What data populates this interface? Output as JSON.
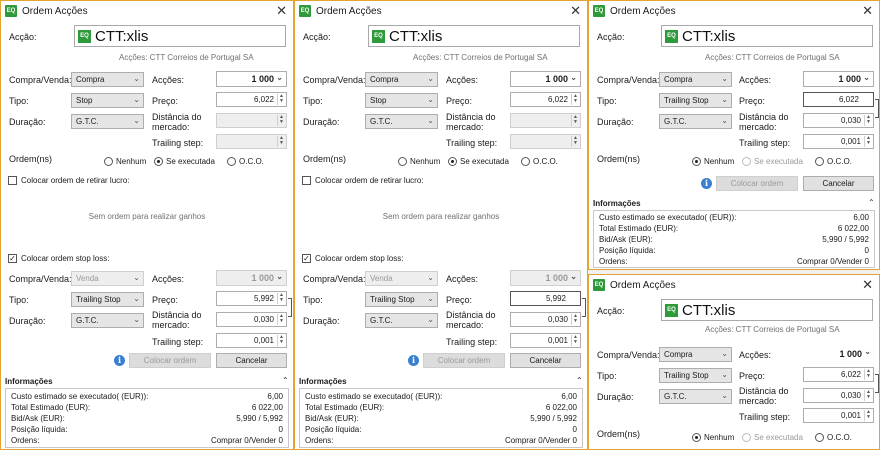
{
  "window_title": "Ordem Acções",
  "app_icon": "EQ",
  "symbol": "CTT:xlis",
  "symbol_subtitle": "Acções: CTT Correios de Portugal SA",
  "labels": {
    "accao": "Acção:",
    "compra_venda": "Compra/Venda:",
    "tipo": "Tipo:",
    "duracao": "Duração:",
    "accoes": "Acções:",
    "preco": "Preço:",
    "distancia_1": "Distância do",
    "distancia_2": "mercado:",
    "trailing_step": "Trailing step:",
    "ordens": "Ordem(ns)",
    "informacoes": "Informações"
  },
  "radio": {
    "nenhum": "Nenhum",
    "se_executada": "Se executada",
    "oco": "O.C.O."
  },
  "checks": {
    "retirar_lucro": "Colocar ordem de retirar lucro:",
    "stop_loss": "Colocar ordem stop loss:"
  },
  "empty_profit_msg": "Sem ordem para realizar ganhos",
  "buttons": {
    "colocar": "Colocar ordem",
    "cancelar": "Cancelar"
  },
  "main_order": {
    "side": "Compra",
    "qty": "1 000",
    "duration": "G.T.C."
  },
  "stop_order": {
    "type": "Stop",
    "price": "6,022"
  },
  "trailing_order": {
    "type": "Trailing Stop",
    "price": "6,022",
    "distance": "0,030",
    "step": "0,001"
  },
  "stop_loss": {
    "side": "Venda",
    "qty": "1 000",
    "type": "Trailing Stop",
    "price": "5,992",
    "distance": "0,030",
    "step": "0,001",
    "duration": "G.T.C."
  },
  "info": {
    "custo_label": "Custo estimado se executado( (EUR)):",
    "custo_value": "6,00",
    "total_label": "Total Estimado (EUR):",
    "total_value": "6 022,00",
    "bidask_label": "Bid/Ask (EUR):",
    "bidask_value": "5,990 / 5,992",
    "posicao_label": "Posição líquida:",
    "posicao_value": "0",
    "ordens_label": "Ordens:",
    "ordens_value": "Comprar 0/Vender 0"
  },
  "colors": {
    "accent_border": "#e3a530",
    "icon_green": "#2e9a3a",
    "info_blue": "#3b7fd0"
  }
}
